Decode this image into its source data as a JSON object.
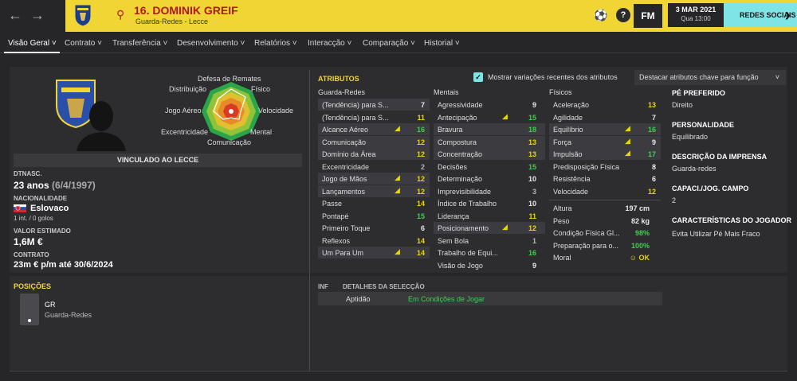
{
  "nav": {
    "back": "←",
    "forward": "→"
  },
  "player": {
    "title": "16. DOMINIK GREIF",
    "subtitle": "Guarda-Redes - Lecce"
  },
  "topbar": {
    "help_icon": "?",
    "fm_logo": "FM",
    "date": "3 MAR 2021",
    "time": "Qua 13:00",
    "social_label": "REDES SOCIAIS"
  },
  "tabs": [
    "Visão Geral",
    "Contrato",
    "Transferência",
    "Desenvolvimento",
    "Relatórios",
    "Interacção",
    "Comparação",
    "Historial"
  ],
  "radar_labels": {
    "top": "Defesa de Remates",
    "tl": "Distribuição",
    "tr": "Físico",
    "l": "Jogo Aéreo",
    "r": "Velocidade",
    "bl": "Excentricidade",
    "br": "Mental",
    "bottom": "Comunicação"
  },
  "profile": {
    "contract_bar": "VINCULADO AO LECCE",
    "dob_label": "DTNASC.",
    "age": "23 anos",
    "dob": "(6/4/1997)",
    "nationality_label": "NACIONALIDADE",
    "nationality": "Eslovaco",
    "caps": "1 int. / 0 golos",
    "value_label": "VALOR ESTIMADO",
    "value": "1,6M €",
    "contract_label": "CONTRATO",
    "contract": "23m € p/m até 30/6/2024"
  },
  "positions": {
    "header": "POSIÇÕES",
    "code": "GR",
    "name": "Guarda-Redes"
  },
  "attributes": {
    "header": "ATRIBUTOS",
    "show_changes": "Mostrar variações recentes dos atributos",
    "highlight_dropdown": "Destacar atributos chave para função",
    "gk_header": "Guarda-Redes",
    "mental_header": "Mentais",
    "physical_header": "Físicos",
    "gk": [
      {
        "name": "(Tendência) para S...",
        "value": "7",
        "color": "white",
        "arrow": false,
        "hl": true
      },
      {
        "name": "(Tendência) para S...",
        "value": "11",
        "color": "yellow",
        "arrow": false,
        "hl": false
      },
      {
        "name": "Alcance Aéreo",
        "value": "16",
        "color": "green",
        "arrow": true,
        "hl": true
      },
      {
        "name": "Comunicação",
        "value": "12",
        "color": "yellow",
        "arrow": false,
        "hl": true
      },
      {
        "name": "Domínio da Área",
        "value": "12",
        "color": "yellow",
        "arrow": false,
        "hl": true
      },
      {
        "name": "Excentricidade",
        "value": "2",
        "color": "gray",
        "arrow": false,
        "hl": false
      },
      {
        "name": "Jogo de Mãos",
        "value": "12",
        "color": "yellow",
        "arrow": true,
        "hl": true
      },
      {
        "name": "Lançamentos",
        "value": "12",
        "color": "yellow",
        "arrow": true,
        "hl": true
      },
      {
        "name": "Passe",
        "value": "14",
        "color": "yellow",
        "arrow": false,
        "hl": false
      },
      {
        "name": "Pontapé",
        "value": "15",
        "color": "green",
        "arrow": false,
        "hl": false
      },
      {
        "name": "Primeiro Toque",
        "value": "6",
        "color": "white",
        "arrow": false,
        "hl": false
      },
      {
        "name": "Reflexos",
        "value": "14",
        "color": "yellow",
        "arrow": false,
        "hl": false
      },
      {
        "name": "Um Para Um",
        "value": "14",
        "color": "yellow",
        "arrow": true,
        "hl": true
      }
    ],
    "mental": [
      {
        "name": "Agressividade",
        "value": "9",
        "color": "white",
        "arrow": false,
        "hl": false
      },
      {
        "name": "Antecipação",
        "value": "15",
        "color": "green",
        "arrow": true,
        "hl": false
      },
      {
        "name": "Bravura",
        "value": "18",
        "color": "green",
        "arrow": false,
        "hl": true
      },
      {
        "name": "Compostura",
        "value": "13",
        "color": "yellow",
        "arrow": false,
        "hl": true
      },
      {
        "name": "Concentração",
        "value": "13",
        "color": "yellow",
        "arrow": false,
        "hl": true
      },
      {
        "name": "Decisões",
        "value": "15",
        "color": "green",
        "arrow": false,
        "hl": false
      },
      {
        "name": "Determinação",
        "value": "10",
        "color": "white",
        "arrow": false,
        "hl": false
      },
      {
        "name": "Imprevisibilidade",
        "value": "3",
        "color": "gray",
        "arrow": false,
        "hl": false
      },
      {
        "name": "Índice de Trabalho",
        "value": "10",
        "color": "white",
        "arrow": false,
        "hl": false
      },
      {
        "name": "Liderança",
        "value": "11",
        "color": "yellow",
        "arrow": false,
        "hl": false
      },
      {
        "name": "Posicionamento",
        "value": "12",
        "color": "yellow",
        "arrow": true,
        "hl": true
      },
      {
        "name": "Sem Bola",
        "value": "1",
        "color": "gray",
        "arrow": false,
        "hl": false
      },
      {
        "name": "Trabalho de Equi...",
        "value": "16",
        "color": "green",
        "arrow": false,
        "hl": false
      },
      {
        "name": "Visão de Jogo",
        "value": "9",
        "color": "white",
        "arrow": false,
        "hl": false
      }
    ],
    "physical": [
      {
        "name": "Aceleração",
        "value": "13",
        "color": "yellow",
        "arrow": false,
        "hl": false
      },
      {
        "name": "Agilidade",
        "value": "7",
        "color": "white",
        "arrow": false,
        "hl": false
      },
      {
        "name": "Equilíbrio",
        "value": "16",
        "color": "green",
        "arrow": true,
        "hl": true
      },
      {
        "name": "Força",
        "value": "9",
        "color": "white",
        "arrow": true,
        "hl": true
      },
      {
        "name": "Impulsão",
        "value": "17",
        "color": "green",
        "arrow": true,
        "hl": true
      },
      {
        "name": "Predisposição Física",
        "value": "8",
        "color": "white",
        "arrow": false,
        "hl": false
      },
      {
        "name": "Resistência",
        "value": "6",
        "color": "white",
        "arrow": false,
        "hl": false
      },
      {
        "name": "Velocidade",
        "value": "12",
        "color": "yellow",
        "arrow": false,
        "hl": false
      }
    ],
    "stats": [
      {
        "name": "Altura",
        "value": "197 cm",
        "color": "white"
      },
      {
        "name": "Peso",
        "value": "82 kg",
        "color": "white"
      },
      {
        "name": "Condição Física Gl...",
        "value": "98%",
        "color": "green"
      },
      {
        "name": "Preparação para o...",
        "value": "100%",
        "color": "green"
      },
      {
        "name": "Moral",
        "value": "OK",
        "color": "yellow"
      }
    ]
  },
  "right": {
    "foot_label": "PÉ PREFERIDO",
    "foot": "Direito",
    "personality_label": "PERSONALIDADE",
    "personality": "Equilibrado",
    "media_label": "DESCRIÇÃO DA IMPRENSA",
    "media": "Guarda-redes",
    "caps_label": "CAPACI./JOG. CAMPO",
    "caps": "2",
    "traits_label": "CARACTERÍSTICAS DO JOGADOR",
    "traits": "Evita Utilizar Pé Mais Fraco"
  },
  "selection": {
    "inf_label": "INF",
    "details_label": "DETALHES DA SELECÇÃO",
    "aptitude_label": "Aptidão",
    "aptitude_value": "Em Condições de Jogar"
  },
  "colors": {
    "accent": "#f0d535",
    "bg": "#262629",
    "green": "#3fcf4d",
    "yellow": "#e8d800",
    "social": "#7ee4e6",
    "name": "#b01818"
  }
}
